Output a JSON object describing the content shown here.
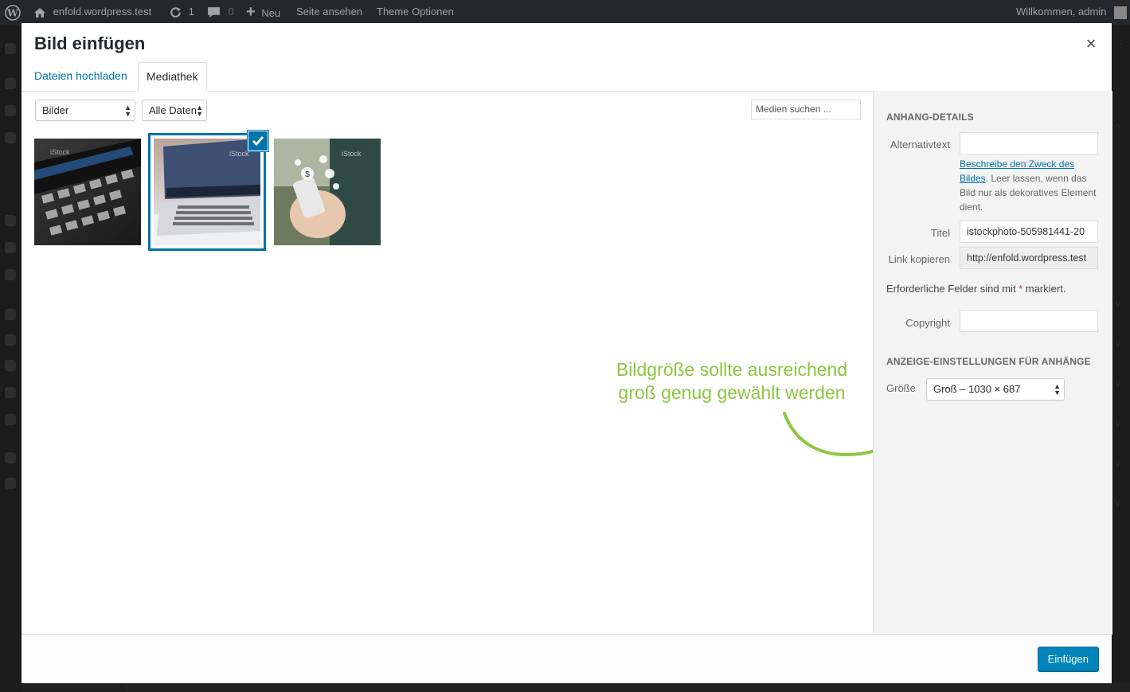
{
  "admin_bar": {
    "site_name": "enfold.wordpress.test",
    "updates_count": "1",
    "comments_count": "0",
    "new_label": "Neu",
    "view_site_label": "Seite ansehen",
    "theme_options_label": "Theme Optionen",
    "welcome_text": "Willkommen, admin"
  },
  "modal": {
    "title": "Bild einfügen",
    "tabs": [
      {
        "label": "Dateien hochladen",
        "active": false
      },
      {
        "label": "Mediathek",
        "active": true
      }
    ],
    "toolbar": {
      "type_filter": "Bilder",
      "date_filter": "Alle Daten",
      "search_placeholder": "Medien suchen ..."
    },
    "attachments": [
      {
        "icon": "laptop-keyboard-photo",
        "selected": false,
        "watermark": "iStock"
      },
      {
        "icon": "laptop-desk-photo",
        "selected": true,
        "watermark": "iStock"
      },
      {
        "icon": "smartphone-coins-photo",
        "selected": false,
        "watermark": "iStock"
      }
    ],
    "annotation": {
      "line1": "Bildgröße sollte ausreichend",
      "line2": "groß genug gewählt werden"
    },
    "details": {
      "heading": "Anhang-Details",
      "alt_label": "Alternativtext",
      "alt_value": "",
      "alt_help_link": "Beschreibe den Zweck des Bildes",
      "alt_help_rest": ". Leer lassen, wenn das Bild nur als dekoratives Element dient.",
      "title_label": "Titel",
      "title_value": "istockphoto-505981441-20",
      "link_label": "Link kopieren",
      "link_value": "http://enfold.wordpress.test",
      "required_text": "Erforderliche Felder sind mit",
      "required_star": "*",
      "required_suffix": "markiert.",
      "copyright_label": "Copyright",
      "copyright_value": "",
      "display_heading": "Anzeige-Einstellungen für Anhänge",
      "size_label": "Größe",
      "size_value": "Groß – 1030 × 687"
    },
    "insert_button": "Einfügen"
  },
  "colors": {
    "accent": "#0073aa",
    "primary_button": "#0085ba",
    "annotation": "#8cc63f",
    "admin_bar": "#23282d"
  }
}
